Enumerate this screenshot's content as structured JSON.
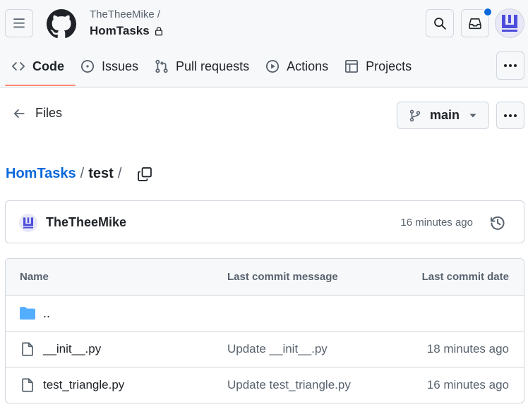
{
  "header": {
    "owner": "TheTheeMike /",
    "repo": "HomTasks",
    "tabs": [
      {
        "label": "Code",
        "icon": "code-icon"
      },
      {
        "label": "Issues",
        "icon": "issue-opened-icon"
      },
      {
        "label": "Pull requests",
        "icon": "git-pull-request-icon"
      },
      {
        "label": "Actions",
        "icon": "play-icon"
      },
      {
        "label": "Projects",
        "icon": "table-icon"
      }
    ]
  },
  "files_nav": {
    "back_label": "Files",
    "branch": "main"
  },
  "breadcrumb": {
    "repo": "HomTasks",
    "sep1": "/",
    "folder": "test",
    "sep2": "/"
  },
  "commit": {
    "author": "TheTheeMike",
    "time": "16 minutes ago"
  },
  "table": {
    "headers": {
      "name": "Name",
      "message": "Last commit message",
      "date": "Last commit date"
    },
    "parent": "..",
    "rows": [
      {
        "name": "__init__.py",
        "message": "Update __init__.py",
        "date": "18 minutes ago"
      },
      {
        "name": "test_triangle.py",
        "message": "Update test_triangle.py",
        "date": "16 minutes ago"
      }
    ]
  },
  "colors": {
    "accent": "#0969da",
    "tab_underline": "#fd8c73",
    "folder": "#54aeff",
    "notification": "#0969da",
    "avatar": "#4d4ddb"
  }
}
